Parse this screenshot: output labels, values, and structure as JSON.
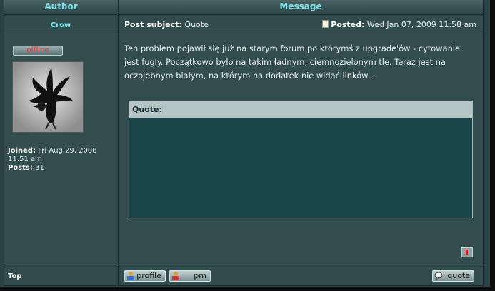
{
  "header": {
    "author_label": "Author",
    "message_label": "Message"
  },
  "post": {
    "author_name": "Crow",
    "subject_label": "Post subject:",
    "subject": "Quote",
    "posted_label": "Posted:",
    "posted_date": "Wed Jan 07, 2009 11:58 am",
    "message": "Ten problem pojawił się już na starym forum po którymś z upgrade'ów - cytowanie jest fugly. Początkowo było na takim ładnym, ciemnozielonym tle. Teraz jest na oczojebnym białym, na którym na dodatek nie widać linków...",
    "quote_label": "Quote:"
  },
  "author": {
    "status": "offline",
    "joined_label": "Joined:",
    "joined_date": "Fri Aug 29, 2008 11:51 am",
    "posts_label": "Posts:",
    "posts_count": "31"
  },
  "footer": {
    "top_label": "Top",
    "profile_label": "profile",
    "pm_label": "pm",
    "quote_label": "quote"
  },
  "colors": {
    "header_text": "#7fdfe7",
    "author_name": "#6ff0f0",
    "status_offline": "#e03b3b",
    "quote_body_bg": "#1a4548",
    "panel_bg": "#334c4e"
  },
  "icons": [
    "post-icon",
    "avatar-image",
    "top-arrow-icon",
    "profile-icon",
    "pm-icon",
    "quote-icon"
  ]
}
